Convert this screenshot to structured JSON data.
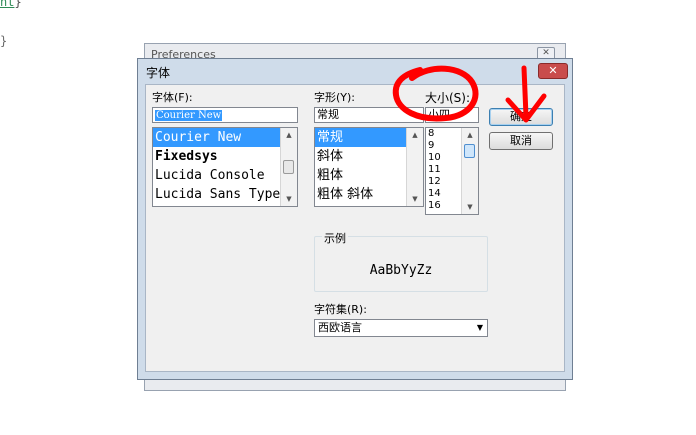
{
  "code": {
    "line1_word": "nt",
    "line1_rest": "}",
    "line2": "}"
  },
  "preferences_window": {
    "title": "Preferences",
    "close_glyph": "✕"
  },
  "dialog": {
    "title": "字体",
    "close_glyph": "✕",
    "font": {
      "label": "字体(F):",
      "value": "Courier New",
      "items": [
        "Courier New",
        "Fixedsys",
        "Lucida Console",
        "Lucida Sans Type"
      ]
    },
    "style": {
      "label": "字形(Y):",
      "value": "常规",
      "items": [
        "常规",
        "斜体",
        "粗体",
        "粗体 斜体"
      ]
    },
    "size": {
      "label": "大小(S):",
      "value": "小四",
      "items": [
        "8",
        "9",
        "10",
        "11",
        "12",
        "14",
        "16"
      ]
    },
    "ok_label": "确定",
    "cancel_label": "取消",
    "sample": {
      "label": "示例",
      "text": "AaBbYyZz"
    },
    "charset": {
      "label": "字符集(R):",
      "value": "西欧语言"
    }
  }
}
